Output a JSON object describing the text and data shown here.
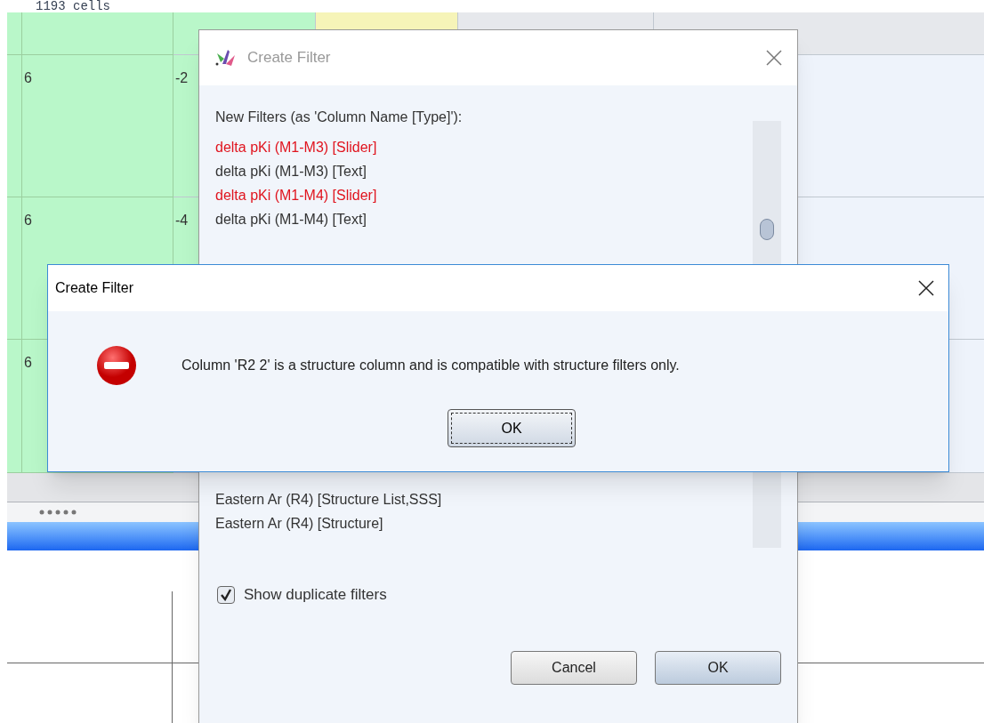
{
  "header_text": "1193 cells",
  "grid": {
    "rows": [
      [
        "6",
        "-2"
      ],
      [
        "6",
        "-4"
      ],
      [
        "6",
        ""
      ]
    ]
  },
  "filter_dialog": {
    "title": "Create Filter",
    "label": "New Filters (as 'Column Name [Type]'):",
    "items_top": [
      {
        "text": "delta pKi (M1-M3) [Slider]",
        "highlighted": true
      },
      {
        "text": "delta pKi (M1-M3) [Text]",
        "highlighted": false
      },
      {
        "text": "delta pKi (M1-M4) [Slider]",
        "highlighted": true
      },
      {
        "text": "delta pKi (M1-M4) [Text]",
        "highlighted": false
      }
    ],
    "items_bottom": [
      {
        "text": "Eastern Ar (R4) [Structure List,SSS]",
        "highlighted": false
      },
      {
        "text": "Eastern Ar (R4) [Structure]",
        "highlighted": false
      }
    ],
    "checkbox": {
      "label": "Show duplicate filters",
      "checked": true
    },
    "buttons": [
      "Cancel",
      "OK"
    ]
  },
  "error_dialog": {
    "title": "Create Filter",
    "message": "Column 'R2 2' is a structure column and is compatible with structure filters only.",
    "button": "OK"
  }
}
